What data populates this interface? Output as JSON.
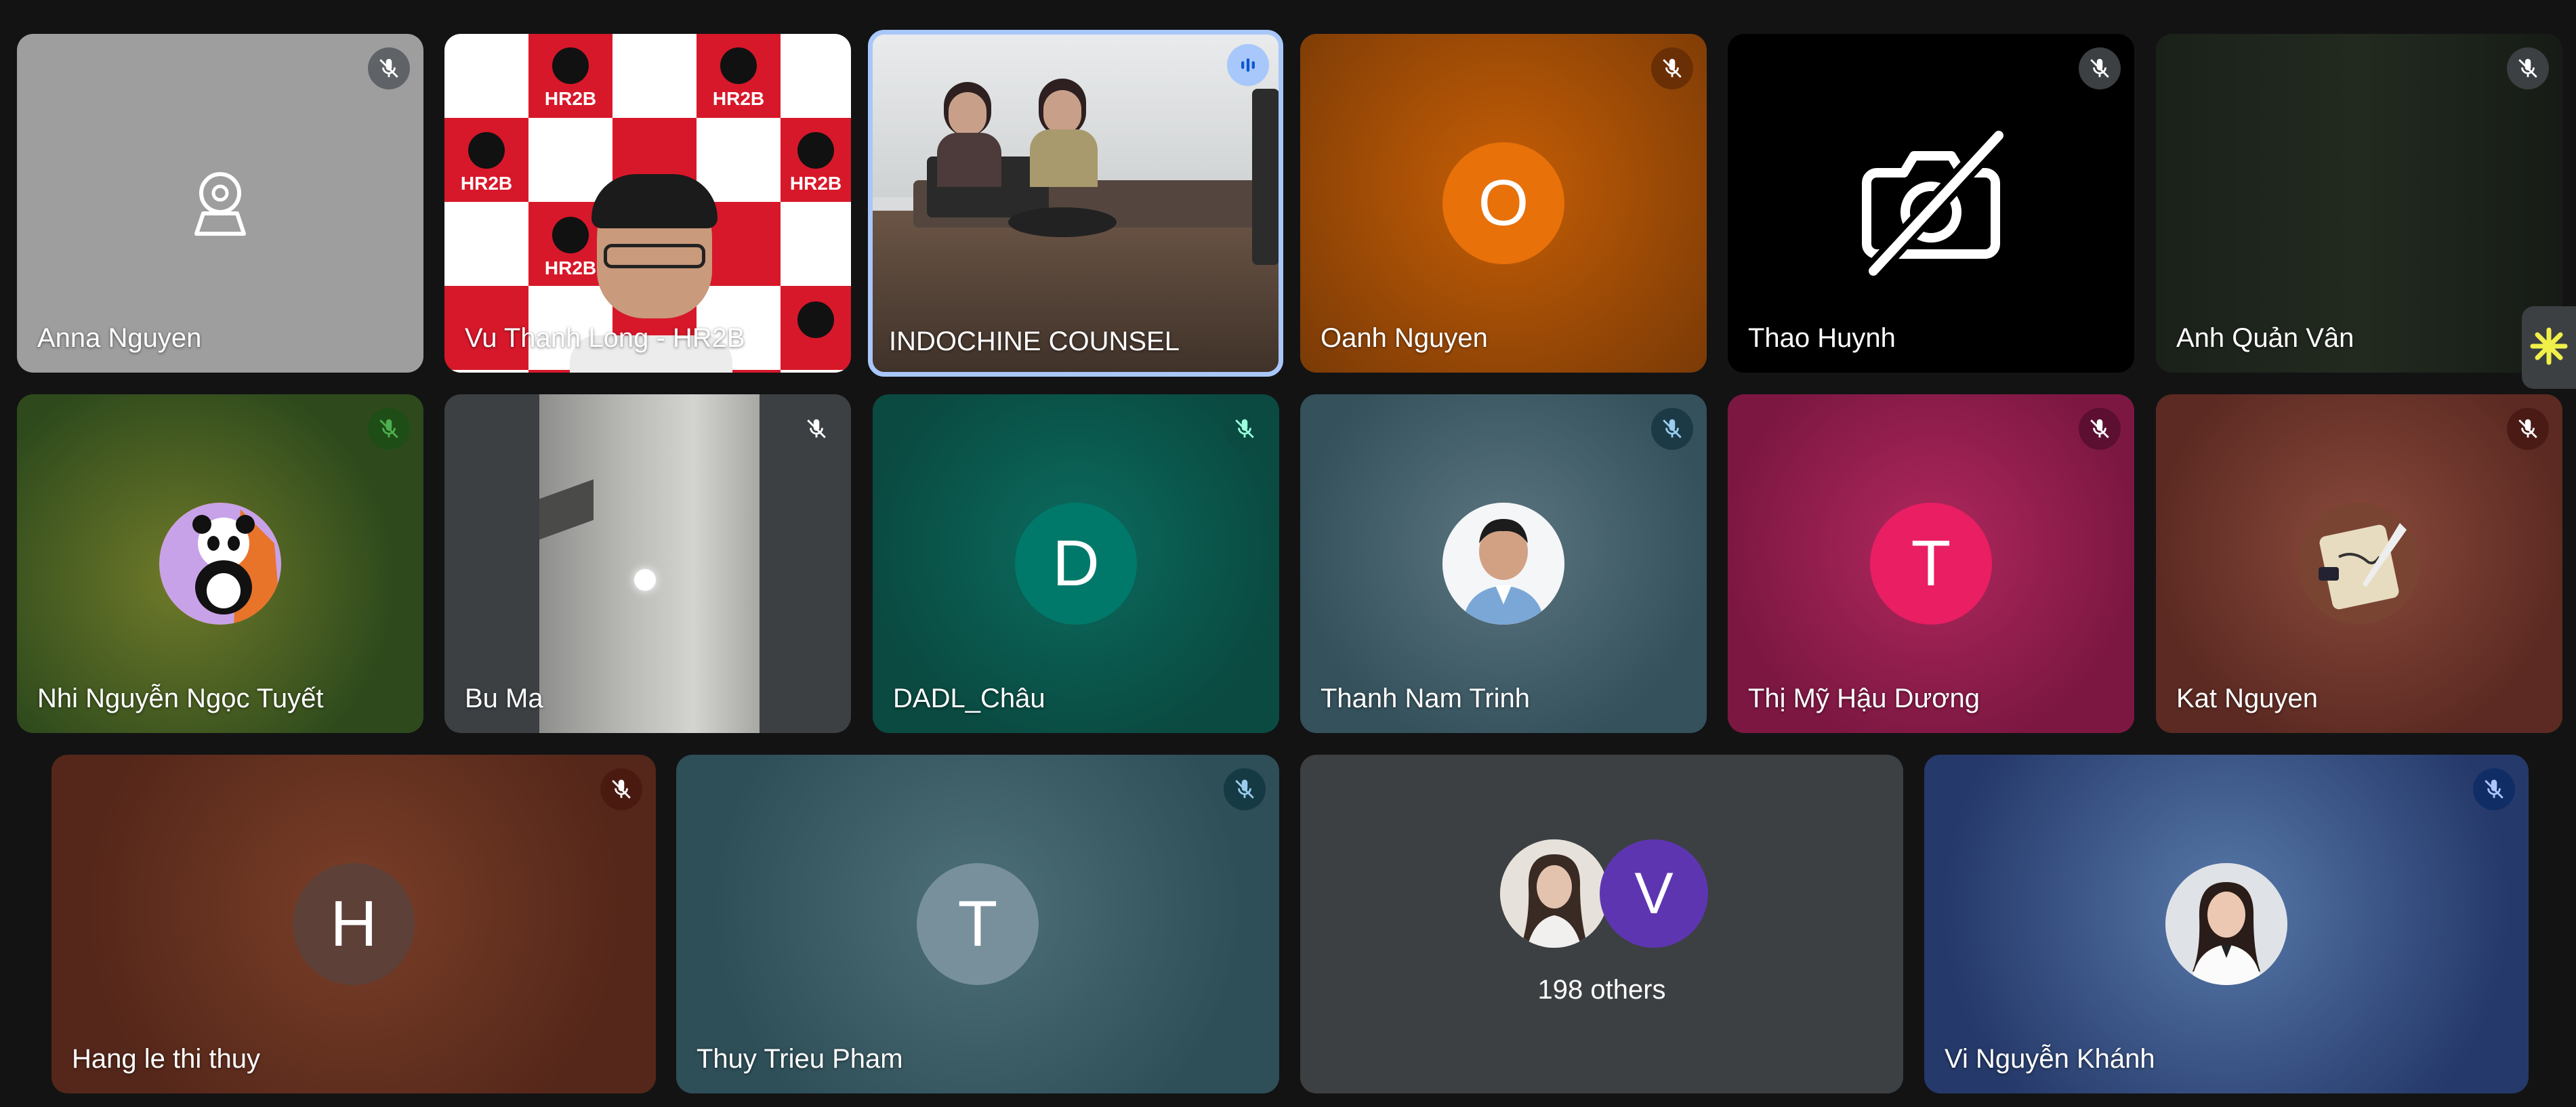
{
  "participants": {
    "anna": {
      "name": "Anna Nguyen"
    },
    "vu": {
      "name": "Vu Thanh Long - HR2B",
      "backdrop_text": "HR2B"
    },
    "indochine": {
      "name": "INDOCHINE COUNSEL"
    },
    "oanh": {
      "name": "Oanh Nguyen",
      "initial": "O"
    },
    "thao": {
      "name": "Thao Huynh"
    },
    "anh": {
      "name": "Anh Quản Vân"
    },
    "nhi": {
      "name": "Nhi Nguyễn Ngọc Tuyết"
    },
    "bu": {
      "name": "Bu Ma"
    },
    "dadl": {
      "name": "DADL_Châu",
      "initial": "D"
    },
    "thanh": {
      "name": "Thanh Nam Trinh"
    },
    "thi": {
      "name": "Thị Mỹ Hậu Dương",
      "initial": "T"
    },
    "kat": {
      "name": "Kat Nguyen"
    },
    "hang": {
      "name": "Hang le thi thuy",
      "initial": "H"
    },
    "thuy": {
      "name": "Thuy Trieu Pham",
      "initial": "T"
    },
    "others": {
      "initial": "V",
      "label": "198 others"
    },
    "vi": {
      "name": "Vi Nguyễn Khánh"
    }
  },
  "icons": {
    "muted": "mic-off-icon",
    "speaking": "audio-level-icon",
    "camera_off": "camera-off-icon",
    "side_panel": "activity-sparkle-icon"
  },
  "colors": {
    "page_bg": "#131314",
    "speaking_border": "#a8c7fa",
    "oanh_avatar": "#e8710a",
    "dadl_avatar": "#00796b",
    "thi_avatar": "#e91e63",
    "hang_avatar": "#5d4037",
    "thuy_avatar": "#78909c",
    "others_avatar": "#5e35b1",
    "side_tab_icon": "#f1f04a"
  }
}
